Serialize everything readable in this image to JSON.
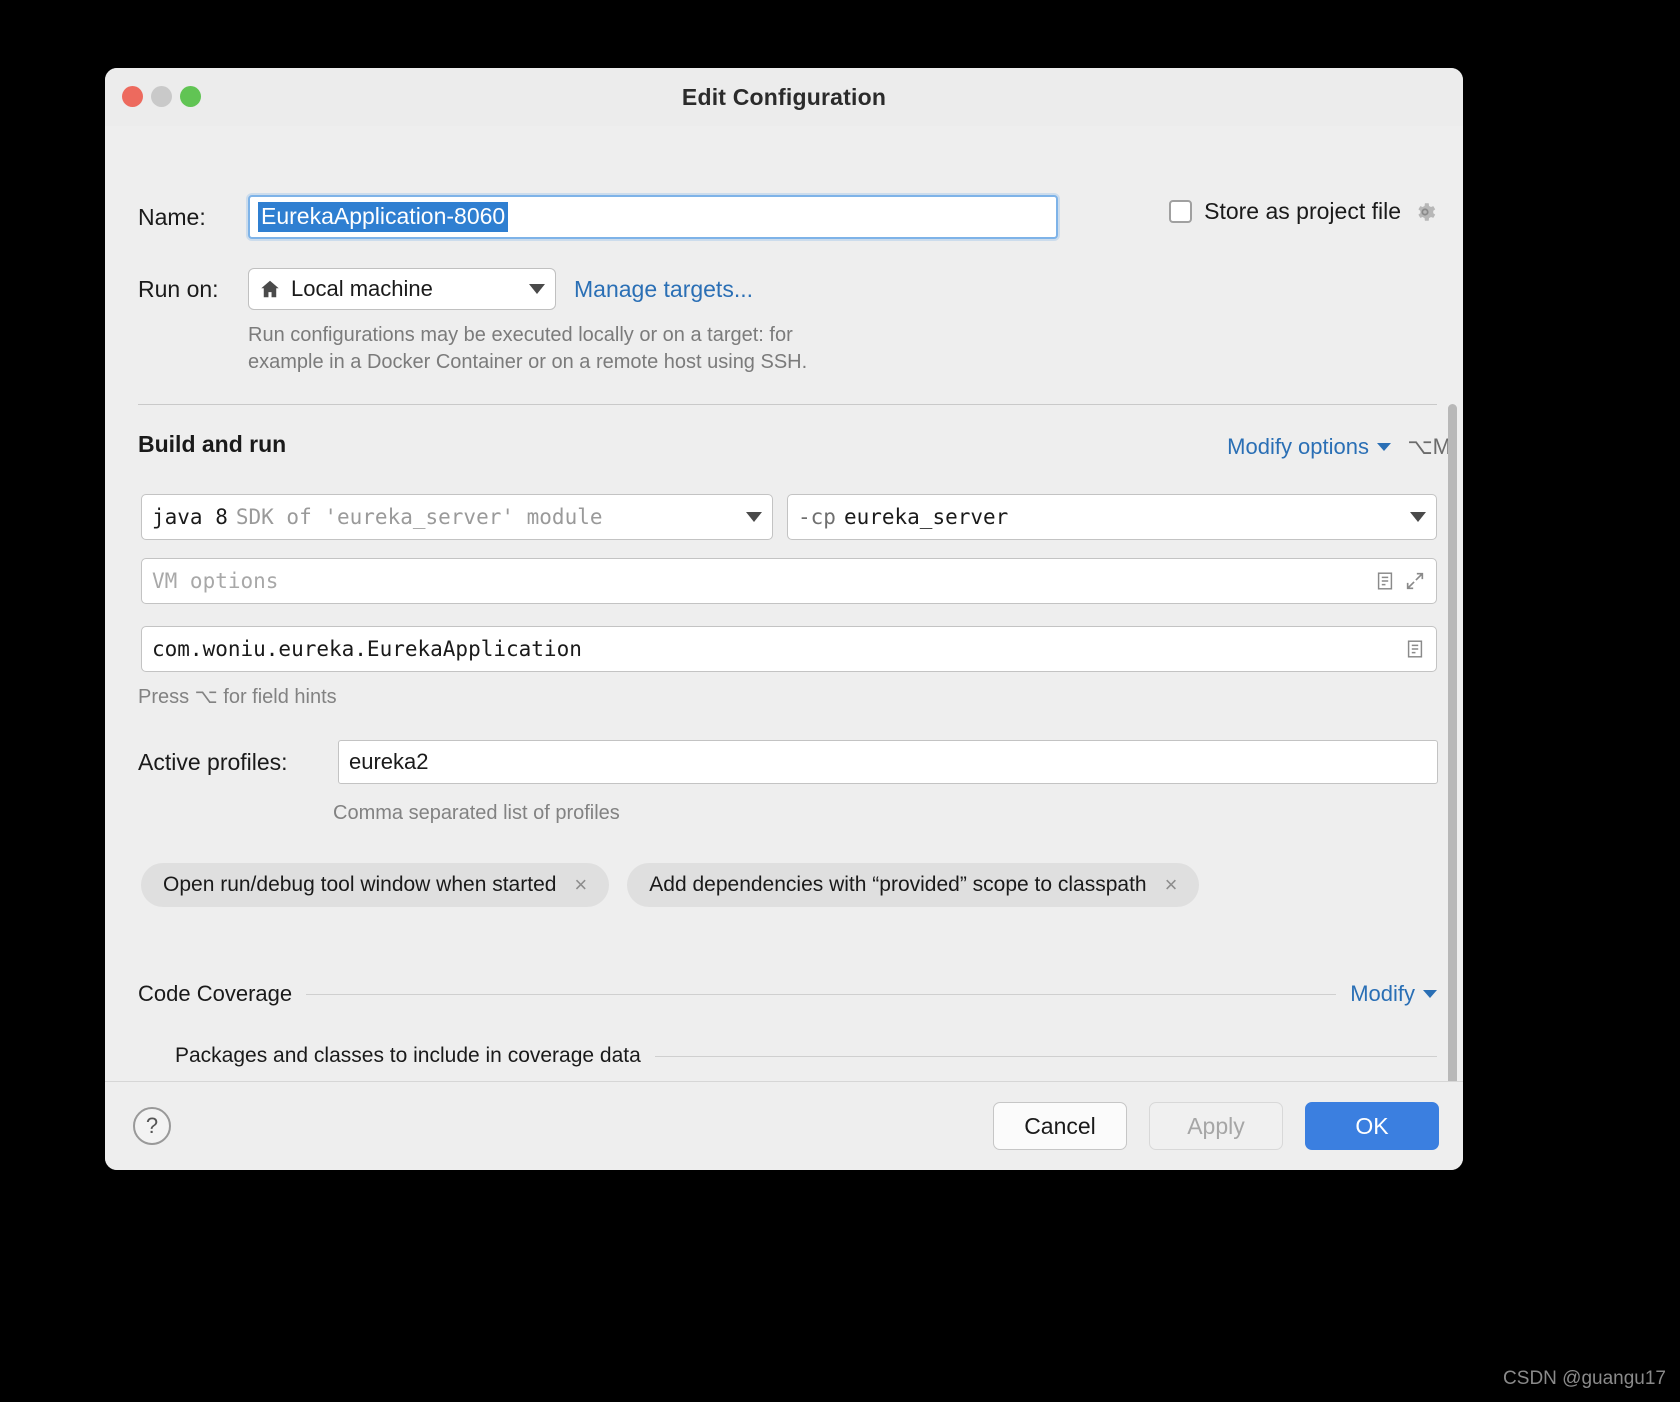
{
  "window": {
    "title": "Edit Configuration",
    "traffic_lights": [
      "close",
      "minimize",
      "zoom"
    ]
  },
  "name_row": {
    "label": "Name:",
    "value": "EurekaApplication-8060",
    "store_as_project_file_label": "Store as project file",
    "store_as_project_file_checked": false
  },
  "run_on": {
    "label": "Run on:",
    "selected": "Local machine",
    "manage_targets_link": "Manage targets...",
    "description_line1": "Run configurations may be executed locally or on a target: for",
    "description_line2": "example in a Docker Container or on a remote host using SSH."
  },
  "build_and_run": {
    "section_title": "Build and run",
    "modify_options_label": "Modify options",
    "modify_options_shortcut": "⌥M",
    "sdk": {
      "main": "java 8",
      "dim": "SDK of 'eureka_server' module"
    },
    "classpath": {
      "prefix": "-cp",
      "value": "eureka_server"
    },
    "vm_options_placeholder": "VM options",
    "main_class": "com.woniu.eureka.EurekaApplication",
    "field_hints": "Press ⌥ for field hints"
  },
  "active_profiles": {
    "label": "Active profiles:",
    "value": "eureka2",
    "description": "Comma separated list of profiles"
  },
  "option_pills": [
    {
      "label": "Open run/debug tool window when started",
      "close": "×"
    },
    {
      "label": "Add dependencies with “provided” scope to classpath",
      "close": "×"
    }
  ],
  "code_coverage": {
    "title": "Code Coverage",
    "modify_label": "Modify",
    "packages_title": "Packages and classes to include in coverage data",
    "toolbar": {
      "remove": "−",
      "add": "+"
    }
  },
  "footer": {
    "help": "?",
    "cancel": "Cancel",
    "apply": "Apply",
    "ok": "OK"
  },
  "watermark": "CSDN @guangu17",
  "colors": {
    "accent_blue": "#3b7fe0",
    "link_blue": "#2a6fb5",
    "selection_blue": "#2f7fd1",
    "dialog_bg": "#eeeeee",
    "field_bg": "#ffffff",
    "pill_bg": "#dfdfdf",
    "muted_text": "#828282"
  }
}
